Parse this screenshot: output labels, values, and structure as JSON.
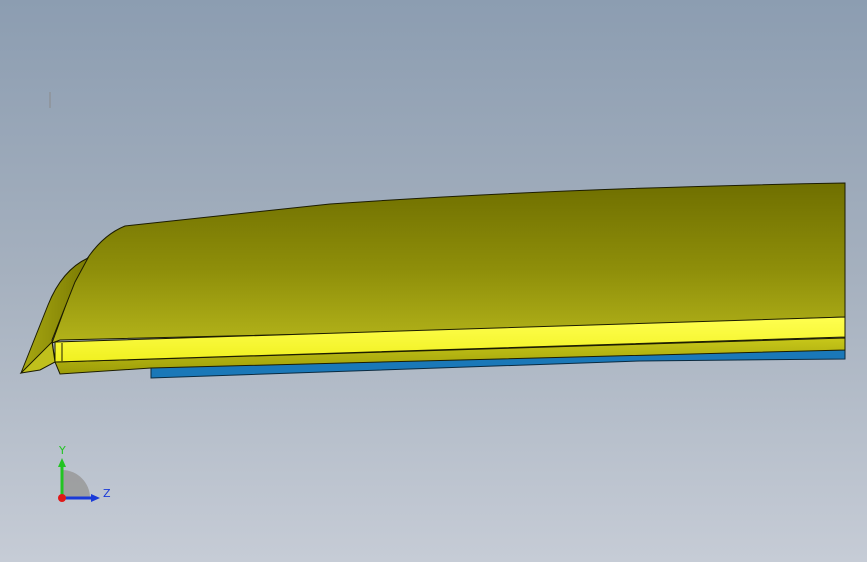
{
  "viewport": {
    "background_top": "#8c9db1",
    "background_bottom": "#c6ccd6"
  },
  "model": {
    "body_color": "#8a8a05",
    "highlight_color": "#ffff30",
    "underside_color": "#1a78b8",
    "edge_color": "#1c1c00"
  },
  "triad": {
    "y_label": "Y",
    "z_label": "Z",
    "y_color": "#22c422",
    "z_color": "#1a3ad8",
    "x_color": "#e01818"
  }
}
